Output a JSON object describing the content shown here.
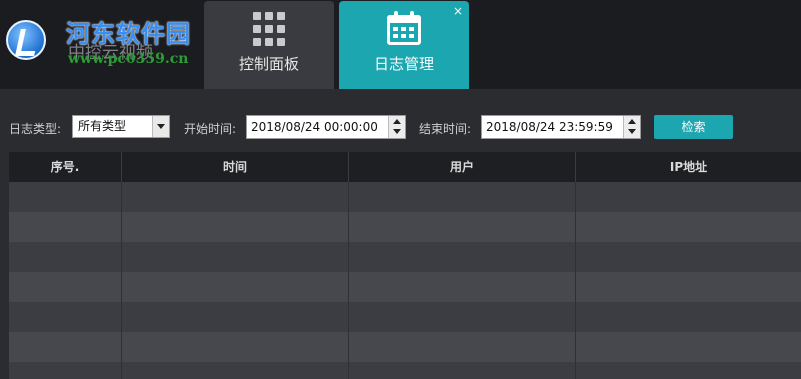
{
  "logo": {
    "title": "河东软件园",
    "ghost_text": "中控云视频",
    "url": "www.pc0359.cn"
  },
  "tabs": [
    {
      "label": "控制面板",
      "icon": "grid-icon",
      "active": false
    },
    {
      "label": "日志管理",
      "icon": "calendar-icon",
      "active": true,
      "close_glyph": "×"
    }
  ],
  "filters": {
    "log_type_label": "日志类型:",
    "log_type_value": "所有类型",
    "start_label": "开始时间:",
    "start_value": "2018/08/24 00:00:00",
    "end_label": "结束时间:",
    "end_value": "2018/08/24 23:59:59",
    "search_label": "检索"
  },
  "table": {
    "columns": [
      "序号.",
      "时间",
      "用户",
      "IP地址"
    ],
    "row_count": 7
  },
  "colors": {
    "accent": "#1ba6b0",
    "topbar": "#1b1c20",
    "background": "#2b2c30"
  }
}
